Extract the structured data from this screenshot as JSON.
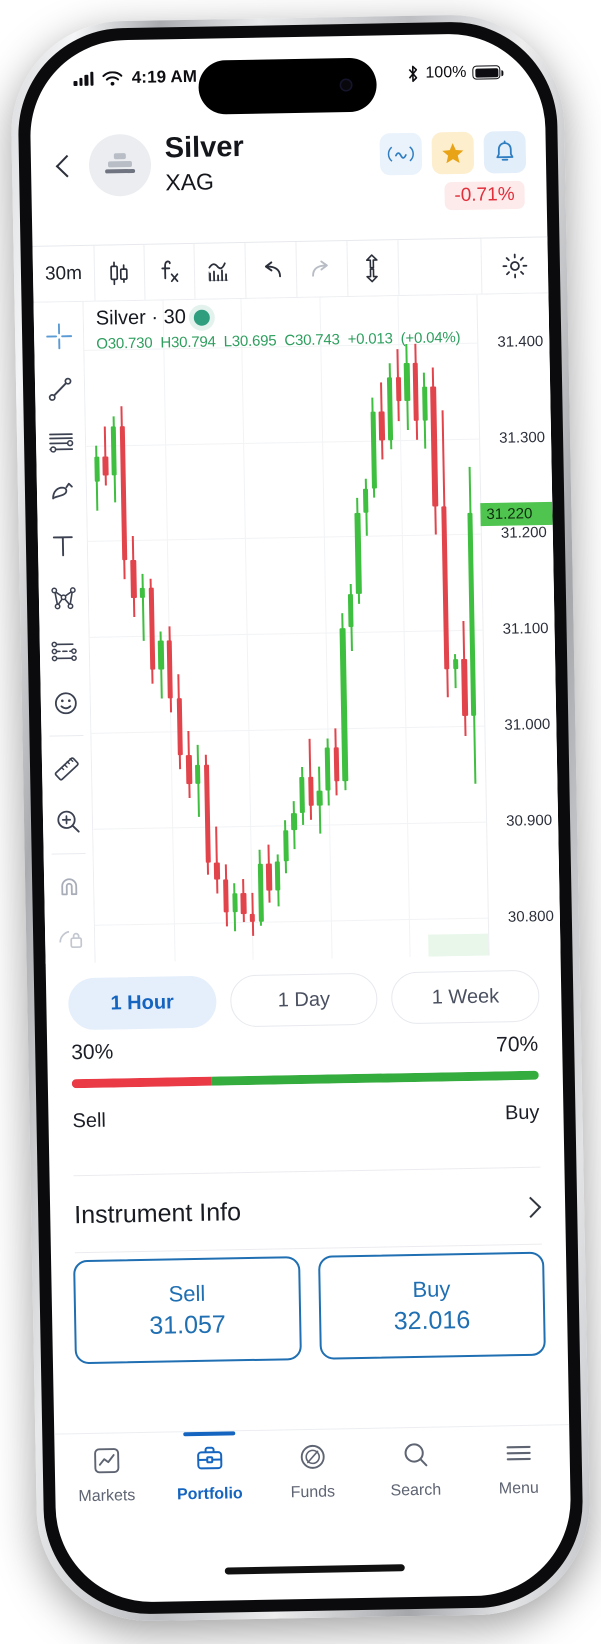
{
  "status_bar": {
    "time": "4:19 AM",
    "battery_percent": "100%",
    "icons": [
      "cellular-signal-icon",
      "wifi-icon",
      "bluetooth-icon",
      "battery-icon"
    ]
  },
  "header": {
    "back_icon": "chevron-left-icon",
    "avatar_icon": "silver-bars-icon",
    "title": "Silver",
    "subtitle": "XAG",
    "change_badge": "-0.71%",
    "actions": [
      {
        "name": "oscillator-button",
        "icon": "oscillator-icon"
      },
      {
        "name": "favorite-button",
        "icon": "star-icon"
      },
      {
        "name": "alert-button",
        "icon": "bell-icon"
      }
    ]
  },
  "chart_toolbar": {
    "interval": "30m",
    "items": [
      {
        "name": "candlestick-type-button",
        "icon": "candlestick-icon"
      },
      {
        "name": "indicators-button",
        "icon": "fx-icon"
      },
      {
        "name": "chart-patterns-button",
        "icon": "bar-chart-icon"
      },
      {
        "name": "undo-button",
        "icon": "undo-arrow-icon"
      },
      {
        "name": "redo-button",
        "icon": "redo-arrow-icon"
      },
      {
        "name": "scale-button",
        "icon": "up-down-arrows-icon"
      }
    ],
    "settings_icon": "gear-icon"
  },
  "drawing_rail": [
    {
      "name": "crosshair-tool",
      "icon": "crosshair-icon",
      "active": true
    },
    {
      "name": "trend-line-tool",
      "icon": "trend-line-icon"
    },
    {
      "name": "horizontal-lines-tool",
      "icon": "horizontal-lines-icon"
    },
    {
      "name": "brush-tool",
      "icon": "brush-icon"
    },
    {
      "name": "text-tool",
      "icon": "text-t-icon"
    },
    {
      "name": "pattern-tool",
      "icon": "pitchfork-icon"
    },
    {
      "name": "prediction-tool",
      "icon": "prediction-icon"
    },
    {
      "name": "emoji-tool",
      "icon": "smiley-icon"
    },
    {
      "name": "measure-tool",
      "icon": "ruler-icon"
    },
    {
      "name": "zoom-tool",
      "icon": "zoom-in-icon"
    },
    {
      "name": "magnet-tool",
      "icon": "magnet-icon"
    },
    {
      "name": "lock-tool",
      "icon": "lock-icon"
    }
  ],
  "chart_data": {
    "type": "candlestick",
    "title": "Silver · 30",
    "symbol": "Silver",
    "interval": "30",
    "ohlc": {
      "open_label": "O",
      "open": "30.730",
      "high_label": "H",
      "high": "30.794",
      "low_label": "L",
      "low": "30.695",
      "close_label": "C",
      "close": "30.743",
      "change": "+0.013",
      "change_percent": "(+0.04%)"
    },
    "ylabel": "",
    "ytick_labels": [
      "31.400",
      "31.300",
      "31.200",
      "31.100",
      "31.000",
      "30.900",
      "30.800"
    ],
    "ylim": [
      30.76,
      31.45
    ],
    "current_price_label": "31.220",
    "current_price": 31.22,
    "up_color": "#3fbf3f",
    "down_color": "#e2444c",
    "candles": [
      {
        "o": 31.262,
        "h": 31.3,
        "l": 31.232,
        "c": 31.288
      },
      {
        "o": 31.288,
        "h": 31.32,
        "l": 31.258,
        "c": 31.268
      },
      {
        "o": 31.268,
        "h": 31.33,
        "l": 31.24,
        "c": 31.32
      },
      {
        "o": 31.32,
        "h": 31.34,
        "l": 31.16,
        "c": 31.18
      },
      {
        "o": 31.18,
        "h": 31.205,
        "l": 31.12,
        "c": 31.14
      },
      {
        "o": 31.14,
        "h": 31.165,
        "l": 31.095,
        "c": 31.15
      },
      {
        "o": 31.15,
        "h": 31.16,
        "l": 31.05,
        "c": 31.065
      },
      {
        "o": 31.065,
        "h": 31.105,
        "l": 31.035,
        "c": 31.095
      },
      {
        "o": 31.095,
        "h": 31.11,
        "l": 31.02,
        "c": 31.035
      },
      {
        "o": 31.035,
        "h": 31.06,
        "l": 30.96,
        "c": 30.975
      },
      {
        "o": 30.975,
        "h": 31.0,
        "l": 30.93,
        "c": 30.945
      },
      {
        "o": 30.945,
        "h": 30.985,
        "l": 30.91,
        "c": 30.965
      },
      {
        "o": 30.965,
        "h": 30.975,
        "l": 30.85,
        "c": 30.862
      },
      {
        "o": 30.862,
        "h": 30.9,
        "l": 30.83,
        "c": 30.845
      },
      {
        "o": 30.845,
        "h": 30.86,
        "l": 30.795,
        "c": 30.81
      },
      {
        "o": 30.81,
        "h": 30.84,
        "l": 30.79,
        "c": 30.83
      },
      {
        "o": 30.83,
        "h": 30.845,
        "l": 30.8,
        "c": 30.808
      },
      {
        "o": 30.808,
        "h": 30.83,
        "l": 30.785,
        "c": 30.8
      },
      {
        "o": 30.8,
        "h": 30.875,
        "l": 30.795,
        "c": 30.86
      },
      {
        "o": 30.86,
        "h": 30.88,
        "l": 30.82,
        "c": 30.832
      },
      {
        "o": 30.832,
        "h": 30.87,
        "l": 30.815,
        "c": 30.862
      },
      {
        "o": 30.862,
        "h": 30.905,
        "l": 30.85,
        "c": 30.895
      },
      {
        "o": 30.895,
        "h": 30.925,
        "l": 30.875,
        "c": 30.912
      },
      {
        "o": 30.912,
        "h": 30.96,
        "l": 30.9,
        "c": 30.95
      },
      {
        "o": 30.95,
        "h": 30.99,
        "l": 30.905,
        "c": 30.92
      },
      {
        "o": 30.92,
        "h": 30.96,
        "l": 30.89,
        "c": 30.935
      },
      {
        "o": 30.935,
        "h": 30.99,
        "l": 30.92,
        "c": 30.98
      },
      {
        "o": 30.98,
        "h": 31.0,
        "l": 30.93,
        "c": 30.945
      },
      {
        "o": 30.945,
        "h": 31.12,
        "l": 30.935,
        "c": 31.105
      },
      {
        "o": 31.105,
        "h": 31.15,
        "l": 31.08,
        "c": 31.14
      },
      {
        "o": 31.14,
        "h": 31.24,
        "l": 31.13,
        "c": 31.225
      },
      {
        "o": 31.225,
        "h": 31.26,
        "l": 31.2,
        "c": 31.25
      },
      {
        "o": 31.25,
        "h": 31.345,
        "l": 31.24,
        "c": 31.33
      },
      {
        "o": 31.33,
        "h": 31.36,
        "l": 31.28,
        "c": 31.3
      },
      {
        "o": 31.3,
        "h": 31.38,
        "l": 31.29,
        "c": 31.365
      },
      {
        "o": 31.365,
        "h": 31.395,
        "l": 31.32,
        "c": 31.34
      },
      {
        "o": 31.34,
        "h": 31.4,
        "l": 31.31,
        "c": 31.38
      },
      {
        "o": 31.38,
        "h": 31.4,
        "l": 31.3,
        "c": 31.32
      },
      {
        "o": 31.32,
        "h": 31.37,
        "l": 31.29,
        "c": 31.355
      },
      {
        "o": 31.355,
        "h": 31.375,
        "l": 31.2,
        "c": 31.23
      },
      {
        "o": 31.23,
        "h": 31.33,
        "l": 31.03,
        "c": 31.06
      },
      {
        "o": 31.06,
        "h": 31.075,
        "l": 31.04,
        "c": 31.07
      },
      {
        "o": 31.07,
        "h": 31.11,
        "l": 30.99,
        "c": 31.01
      },
      {
        "o": 31.01,
        "h": 31.27,
        "l": 30.94,
        "c": 31.222
      }
    ]
  },
  "period_selector": {
    "options": [
      "1 Hour",
      "1 Day",
      "1 Week"
    ],
    "selected": "1 Hour"
  },
  "sentiment": {
    "sell_percent": "30%",
    "buy_percent": "70%",
    "sell_label": "Sell",
    "buy_label": "Buy",
    "sell_value": 30,
    "buy_value": 70,
    "sell_color": "#ea3a46",
    "buy_color": "#35ad3e"
  },
  "instrument_info": {
    "label": "Instrument Info",
    "chevron_icon": "chevron-right-icon"
  },
  "order": {
    "sell_label": "Sell",
    "sell_price": "31.057",
    "buy_label": "Buy",
    "buy_price": "32.016",
    "accent_color": "#1f6fb2"
  },
  "bottom_nav": {
    "items": [
      {
        "label": "Markets",
        "icon": "markets-chart-icon",
        "active": false
      },
      {
        "label": "Portfolio",
        "icon": "briefcase-icon",
        "active": true
      },
      {
        "label": "Funds",
        "icon": "coin-icon",
        "active": false
      },
      {
        "label": "Search",
        "icon": "search-icon",
        "active": false
      },
      {
        "label": "Menu",
        "icon": "hamburger-menu-icon",
        "active": false
      }
    ],
    "active_color": "#1565c0"
  }
}
